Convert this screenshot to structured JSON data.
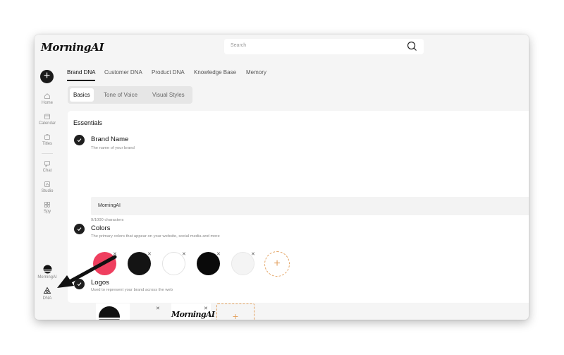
{
  "app": {
    "name": "MorningAI"
  },
  "search": {
    "placeholder": "Search"
  },
  "sidebar": {
    "add_label": "+",
    "items": [
      {
        "label": "Home",
        "icon": "home-icon"
      },
      {
        "label": "Calendar",
        "icon": "calendar-icon"
      },
      {
        "label": "Titles",
        "icon": "titles-icon"
      },
      {
        "label": "Chat",
        "icon": "chat-icon"
      },
      {
        "label": "Studio",
        "icon": "studio-icon"
      },
      {
        "label": "Spy",
        "icon": "spy-icon"
      }
    ],
    "account_label": "MorningAI",
    "dna_label": "DNA"
  },
  "tabs": [
    "Brand DNA",
    "Customer DNA",
    "Product DNA",
    "Knowledge Base",
    "Memory"
  ],
  "active_tab": "Brand DNA",
  "subtabs": [
    "Basics",
    "Tone of Voice",
    "Visual Styles"
  ],
  "active_subtab": "Basics",
  "essentials": {
    "title": "Essentials",
    "brand_name": {
      "title": "Brand Name",
      "description": "The name of your brand",
      "value": "MorningAI",
      "char_count": "9/1000 characters"
    },
    "colors": {
      "title": "Colors",
      "description": "The primary colors that appear on your website, social media and more",
      "swatches": [
        "#ef3f5f",
        "#141414",
        "#ffffff",
        "#0a0a0a",
        "#f4f4f4"
      ],
      "add_label": "+"
    },
    "logos": {
      "title": "Logos",
      "description": "Used to represent your brand across the web",
      "wordmark": "MorningAI",
      "add_label": "+"
    }
  },
  "colors": {
    "accent_add": "#e4a464",
    "dark": "#1a1a1a"
  }
}
